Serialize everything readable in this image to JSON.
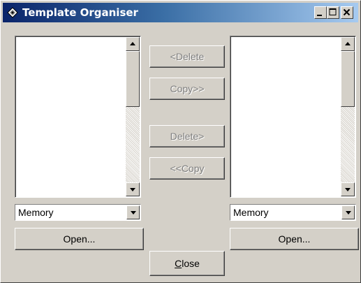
{
  "window": {
    "title": "Template Organiser",
    "controls": {
      "minimize": "_",
      "maximize": "□",
      "close": "×"
    }
  },
  "left_panel": {
    "items": [],
    "storage_select": {
      "selected": "Memory"
    },
    "open_label": "Open..."
  },
  "right_panel": {
    "items": [],
    "storage_select": {
      "selected": "Memory"
    },
    "open_label": "Open..."
  },
  "actions": {
    "delete_left": "<Delete",
    "copy_right": "Copy>>",
    "delete_right": "Delete>",
    "copy_left": "<<Copy",
    "close_prefix": "",
    "close_mnemonic": "C",
    "close_suffix": "lose"
  },
  "colors": {
    "titlebar_start": "#0a246a",
    "titlebar_end": "#a6caf0",
    "face": "#d4d0c8",
    "disabled_text": "#808080"
  }
}
